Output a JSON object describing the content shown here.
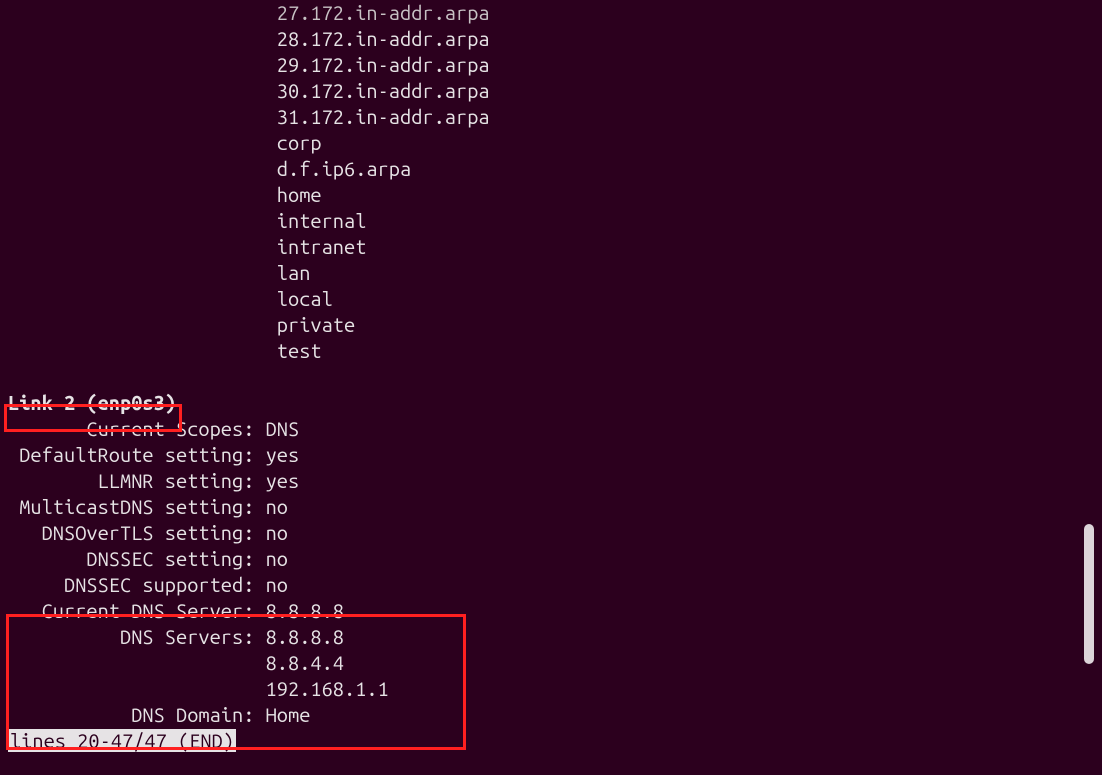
{
  "top_list": {
    "partial_top": "27.172.in-addr.arpa",
    "items": [
      "28.172.in-addr.arpa",
      "29.172.in-addr.arpa",
      "30.172.in-addr.arpa",
      "31.172.in-addr.arpa",
      "corp",
      "d.f.ip6.arpa",
      "home",
      "internal",
      "intranet",
      "lan",
      "local",
      "private",
      "test"
    ]
  },
  "link": {
    "heading": "Link 2 (enp0s3)",
    "rows": [
      {
        "label": "Current Scopes:",
        "value": "DNS"
      },
      {
        "label": "DefaultRoute setting:",
        "value": "yes"
      },
      {
        "label": "LLMNR setting:",
        "value": "yes"
      },
      {
        "label": "MulticastDNS setting:",
        "value": "no"
      },
      {
        "label": "DNSOverTLS setting:",
        "value": "no"
      },
      {
        "label": "DNSSEC setting:",
        "value": "no"
      },
      {
        "label": "DNSSEC supported:",
        "value": "no"
      },
      {
        "label": "Current DNS Server:",
        "value": "8.8.8.8"
      },
      {
        "label": "DNS Servers:",
        "value": "8.8.8.8"
      },
      {
        "label": "",
        "value": "8.8.4.4"
      },
      {
        "label": "",
        "value": "192.168.1.1"
      },
      {
        "label": "DNS Domain:",
        "value": "Home"
      }
    ]
  },
  "pager": {
    "status": "lines 20-47/47 (END)"
  },
  "layout": {
    "label_col_width": 22,
    "value_col_start": 24
  }
}
